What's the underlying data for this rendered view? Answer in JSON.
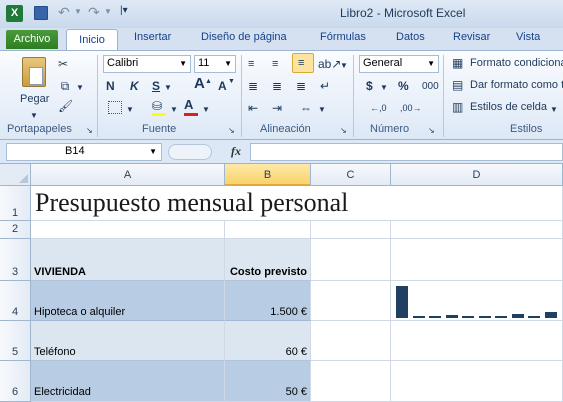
{
  "window": {
    "title": "Libro2 - Microsoft Excel"
  },
  "tabs": {
    "archivo": "Archivo",
    "inicio": "Inicio",
    "insertar": "Insertar",
    "diseno": "Diseño de página",
    "formulas": "Fórmulas",
    "datos": "Datos",
    "revisar": "Revisar",
    "vista": "Vista"
  },
  "ribbon": {
    "pegar": "Pegar",
    "font_name": "Calibri",
    "font_size": "11",
    "bold": "N",
    "italic": "K",
    "underline": "S",
    "grow_font": "A",
    "shrink_font": "A",
    "number_format": "General",
    "currency": "$",
    "percent": "%",
    "thousands": "000",
    "formato_condicional": "Formato condicional",
    "dar_formato": "Dar formato como tabla",
    "estilos_celda": "Estilos de celda",
    "groups": {
      "portapapeles": "Portapapeles",
      "fuente": "Fuente",
      "alineacion": "Alineación",
      "numero": "Número",
      "estilos": "Estilos"
    }
  },
  "formula_bar": {
    "name_box": "B14",
    "fx": "fx",
    "formula": ""
  },
  "grid": {
    "columns": [
      "A",
      "B",
      "C",
      "D"
    ],
    "rows": [
      "1",
      "2",
      "3",
      "4",
      "5",
      "6"
    ],
    "title": "Presupuesto mensual personal",
    "header_a": "VIVIENDA",
    "header_b": "Costo previsto",
    "items": [
      {
        "label": "Hipoteca o alquiler",
        "value": "1.500 €"
      },
      {
        "label": "Teléfono",
        "value": "60 €"
      },
      {
        "label": "Electricidad",
        "value": "50 €"
      }
    ]
  },
  "sparkline": {
    "values": [
      1500,
      60,
      50,
      160,
      60,
      60,
      60,
      200,
      60,
      300
    ],
    "color": "#1f3f63"
  },
  "colors": {
    "selected_col": "#fcd86f",
    "row_alt_a": "#dce6f1",
    "row_alt_b": "#b8cce4",
    "archivo": "#3a8a2d"
  }
}
